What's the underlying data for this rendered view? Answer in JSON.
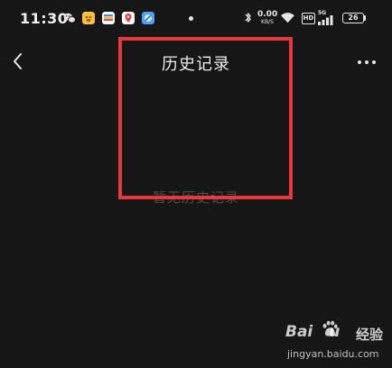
{
  "status_bar": {
    "time": "11:30",
    "notification_icons": [
      "wechat-icon",
      "pet-app-icon",
      "wallet-app-icon",
      "maps-app-icon",
      "browser-app-icon"
    ],
    "net_speed_value": "0.00",
    "net_speed_unit": "KB/S",
    "hd_label": "HD",
    "signal_label": "5G",
    "battery_level": "26"
  },
  "nav": {
    "title": "历史记录",
    "back_icon": "chevron-left-icon",
    "more_icon": "more-dots-icon"
  },
  "empty_state": {
    "message": "暂无历史记录"
  },
  "annotation": {
    "color": "#e8383b"
  },
  "watermark": {
    "brand": "Bai",
    "brand_suffix": "u",
    "brand_cn": "经验",
    "url": "jingyan.baidu.com"
  },
  "colors": {
    "background": "#161616",
    "text_primary": "#ececec",
    "text_muted": "#4c4c4c"
  }
}
